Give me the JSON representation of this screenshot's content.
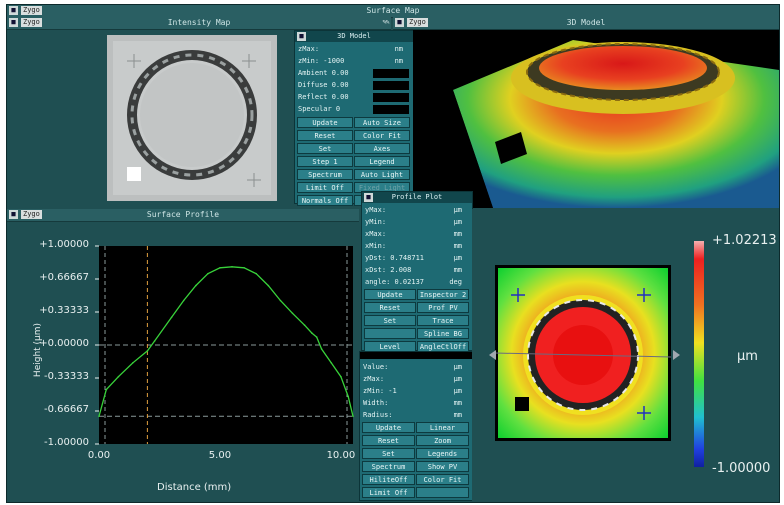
{
  "window": {
    "title": "Surface Map",
    "logo": "Zygo"
  },
  "intensity_map": {
    "title": "Intensity Map",
    "logo": "Zygo"
  },
  "model_3d": {
    "title": "3D Model",
    "logo": "Zygo"
  },
  "model_controls": {
    "title": "3D Model",
    "rows": [
      {
        "label": "zMax:",
        "unit": "nm"
      },
      {
        "label": "zMin: -1000",
        "unit": "nm"
      },
      {
        "label": "Ambient  0.00",
        "unit": ""
      },
      {
        "label": "Diffuse  0.00",
        "unit": ""
      },
      {
        "label": "Reflect  0.00",
        "unit": ""
      },
      {
        "label": "Specular 0",
        "unit": ""
      }
    ],
    "buttons": [
      [
        "Update",
        "Auto Size"
      ],
      [
        "Reset",
        "Color Fit"
      ],
      [
        "Set",
        "Axes"
      ],
      [
        "Step 1",
        "Legend"
      ],
      [
        "Spectrum",
        "Auto Light"
      ],
      [
        "Limit Off",
        "Fixed Light"
      ],
      [
        "Normals Off",
        ""
      ]
    ]
  },
  "surface_profile": {
    "title": "Surface Profile",
    "logo": "Zygo"
  },
  "profile_plot": {
    "title": "Profile Plot",
    "rows": [
      {
        "label": "yMax:",
        "unit": "µm"
      },
      {
        "label": "yMin:",
        "unit": "µm"
      },
      {
        "label": "xMax:",
        "unit": "mm"
      },
      {
        "label": "xMin:",
        "unit": "mm"
      },
      {
        "label": "yDst:  0.748711",
        "unit": "µm"
      },
      {
        "label": "xDst:  2.008",
        "unit": "mm"
      },
      {
        "label": "angle:  0.02137",
        "unit": "deg"
      }
    ],
    "buttons": [
      [
        "Update",
        "Inspector 2"
      ],
      [
        "Reset",
        "Prof PV"
      ],
      [
        "Set",
        "Trace"
      ],
      [
        "",
        "Spline BG"
      ],
      [
        "Level",
        "AngleCtlOff"
      ]
    ]
  },
  "map_controls": {
    "rows": [
      {
        "label": "Value:",
        "unit": "µm"
      },
      {
        "label": "zMax:",
        "unit": "µm"
      },
      {
        "label": "zMin: -1",
        "unit": "µm"
      },
      {
        "label": "Width:",
        "unit": "mm"
      },
      {
        "label": "Radius:",
        "unit": "mm"
      }
    ],
    "buttons": [
      [
        "Update",
        "Linear"
      ],
      [
        "Reset",
        "Zoom"
      ],
      [
        "Set",
        "Legends"
      ],
      [
        "Spectrum",
        "Show PV"
      ],
      [
        "HiliteOff",
        "Color Fit"
      ],
      [
        "Limit Off",
        ""
      ]
    ]
  },
  "colorbar": {
    "max_label": "+1.02213",
    "min_label": "-1.00000",
    "unit": "µm"
  },
  "chart_data": {
    "type": "line",
    "xlabel": "Distance (mm)",
    "ylabel": "Height (µm)",
    "xlim": [
      0,
      10.5
    ],
    "ylim": [
      -1,
      1
    ],
    "xticks": [
      "0.00",
      "5.00",
      "10.00"
    ],
    "yticks": [
      "+1.00000",
      "+0.66667",
      "+0.33333",
      "+0.00000",
      "-0.33333",
      "-0.66667",
      "-1.00000"
    ],
    "series": [
      {
        "x": [
          0.0,
          0.3,
          0.8,
          1.4,
          2.0,
          2.3,
          3.0,
          3.5,
          4.0,
          4.5,
          5.0,
          5.5,
          6.0,
          6.5,
          7.0,
          7.5,
          8.0,
          8.5,
          8.8,
          9.0,
          9.2,
          9.6,
          10.0,
          10.3,
          10.5
        ],
        "y": [
          -0.72,
          -0.45,
          -0.32,
          -0.18,
          -0.06,
          0.04,
          0.28,
          0.45,
          0.6,
          0.72,
          0.78,
          0.79,
          0.78,
          0.72,
          0.6,
          0.45,
          0.32,
          0.2,
          0.12,
          0.08,
          -0.04,
          -0.18,
          -0.32,
          -0.52,
          -0.72
        ]
      }
    ],
    "reference_lines": {
      "y": [
        0.0,
        -0.72
      ],
      "x": [
        2.0
      ]
    }
  },
  "colors": {
    "background": "#1f4f52",
    "trace": "#38d23a",
    "cursor": "#e0a040"
  }
}
